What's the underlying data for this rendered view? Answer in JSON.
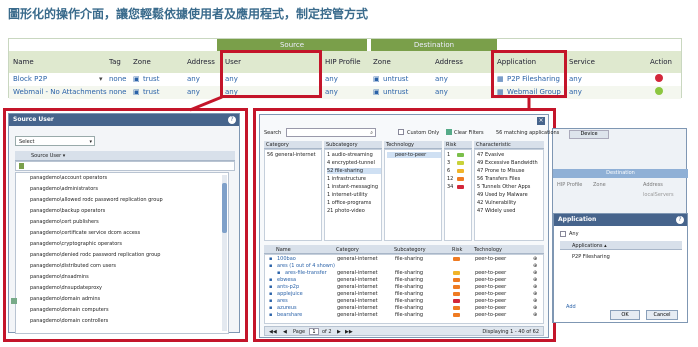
{
  "heading": "圖形化的操作介面，讓您輕鬆依據使用者及應用程式，制定控管方式",
  "top_table": {
    "groups": {
      "source": "Source",
      "destination": "Destination"
    },
    "columns": [
      "Name",
      "Tag",
      "Zone",
      "Address",
      "User",
      "HIP Profile",
      "Zone",
      "Address",
      "Application",
      "Service",
      "Action"
    ],
    "rows": [
      {
        "name": "Block P2P",
        "tag": "none",
        "zone": "trust",
        "address": "any",
        "user": "any",
        "hip": "any",
        "dzone": "untrust",
        "daddress": "any",
        "application": "P2P Filesharing",
        "service": "any"
      },
      {
        "name": "Webmail - No Attachments",
        "tag": "none",
        "zone": "trust",
        "address": "any",
        "user": "any",
        "hip": "any",
        "dzone": "untrust",
        "daddress": "any",
        "application": "Webmail Group",
        "service": "any"
      }
    ]
  },
  "source_user": {
    "title": "Source User",
    "select": "Select",
    "column": "Source User ▾",
    "users": [
      "panagdemo\\account operators",
      "panagdemo\\administrators",
      "panagdemo\\allowed rodc password replication group",
      "panagdemo\\backup operators",
      "panagdemo\\cert publishers",
      "panagdemo\\certificate service dcom access",
      "panagdemo\\cryptographic operators",
      "panagdemo\\denied rodc password replication group",
      "panagdemo\\distributed com users",
      "panagdemo\\dnsadmins",
      "panagdemo\\dnsupdateproxy",
      "panagdemo\\domain admins",
      "panagdemo\\domain computers",
      "panagdemo\\domain controllers"
    ]
  },
  "app_filter": {
    "search_label": "Search",
    "custom_only": "Custom Only",
    "clear_filters": "Clear Filters",
    "matching": "56 matching applications",
    "cat_header": "Category",
    "cat_items": [
      "56 general-internet"
    ],
    "sub_header": "Subcategory",
    "sub_items": [
      "1 audio-streaming",
      "4 encrypted-tunnel",
      "52 file-sharing",
      "1 infrastructure",
      "1 instant-messaging",
      "1 internet-utility",
      "1 office-programs",
      "21 photo-video"
    ],
    "tech_header": "Technology",
    "tech_items": [
      "peer-to-peer"
    ],
    "risk_header": "Risk",
    "risk_items": [
      "1",
      "3",
      "6",
      "12",
      "34"
    ],
    "char_header": "Characteristic",
    "char_items": [
      "47 Evasive",
      "49 Excessive Bandwidth",
      "47 Prone to Misuse",
      "56 Transfers Files",
      "5 Tunnels Other Apps",
      "49 Used by Malware",
      "42 Vulnerability",
      "47 Widely used"
    ],
    "table_columns": [
      "Name",
      "Category",
      "Subcategory",
      "Risk",
      "Technology"
    ],
    "apps": [
      {
        "name": "100bao",
        "cat": "general-internet",
        "sub": "file-sharing",
        "tech": "peer-to-peer"
      },
      {
        "name": "ares (1 out of 4 shown)",
        "cat": "",
        "sub": "",
        "tech": ""
      },
      {
        "name": "ares-file-transfer",
        "cat": "general-internet",
        "sub": "file-sharing",
        "tech": "peer-to-peer"
      },
      {
        "name": "ebwesa",
        "cat": "general-internet",
        "sub": "file-sharing",
        "tech": "peer-to-peer"
      },
      {
        "name": "ants-p2p",
        "cat": "general-internet",
        "sub": "file-sharing",
        "tech": "peer-to-peer"
      },
      {
        "name": "applejuice",
        "cat": "general-internet",
        "sub": "file-sharing",
        "tech": "peer-to-peer"
      },
      {
        "name": "ares",
        "cat": "general-internet",
        "sub": "file-sharing",
        "tech": "peer-to-peer"
      },
      {
        "name": "azureus",
        "cat": "general-internet",
        "sub": "file-sharing",
        "tech": "peer-to-peer"
      },
      {
        "name": "bearshare",
        "cat": "general-internet",
        "sub": "file-sharing",
        "tech": "peer-to-peer"
      }
    ],
    "page_label": "Page",
    "page_value": "1",
    "page_of": "of 2",
    "displaying": "Displaying 1 - 40 of 62"
  },
  "right_panel": {
    "tab_device": "Device",
    "dest_label": "Destination",
    "hip_label": "HIP Profile",
    "zone_label": "Zone",
    "address_label": "Address",
    "localservers": "localServers",
    "application_title": "Application",
    "any_label": "Any",
    "applications_header": "Applications ▴",
    "app_item": "P2P Filesharing",
    "add_label": "Add",
    "ok": "OK",
    "cancel": "Cancel"
  },
  "colors": {
    "highlight": "#c4152a",
    "accent": "#7a9f4a",
    "title_bar": "#46648c",
    "link": "#2a62a8"
  }
}
